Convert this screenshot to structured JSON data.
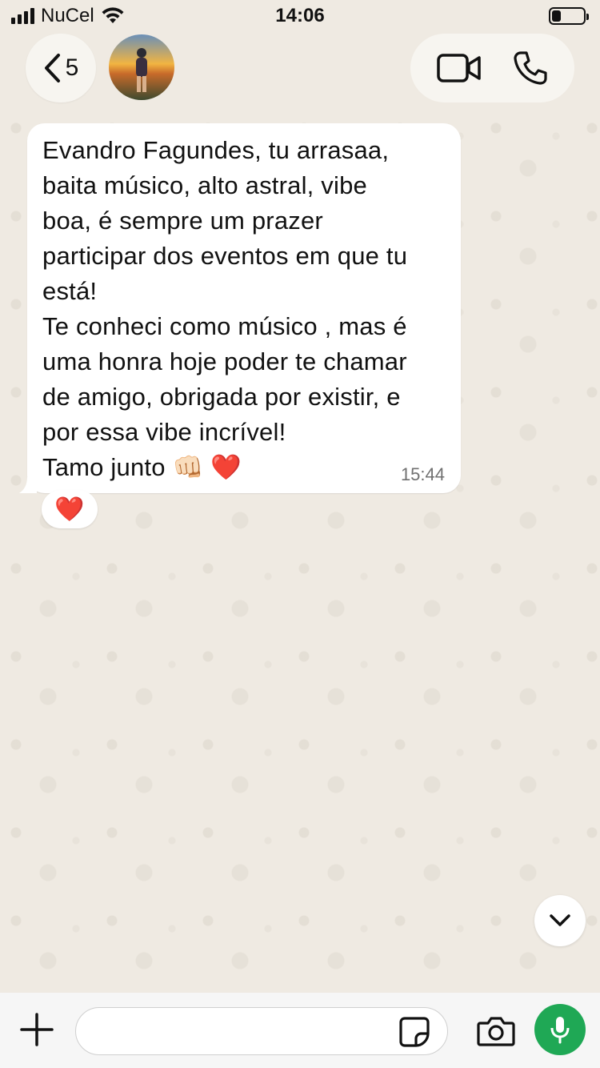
{
  "status_bar": {
    "carrier": "NuCel",
    "time": "14:06"
  },
  "header": {
    "back_count": "5",
    "icons": [
      "chevron-left-icon",
      "video-call-icon",
      "phone-icon"
    ]
  },
  "message": {
    "text": "Evandro Fagundes, tu arrasaa,\nbaita músico, alto astral, vibe\nboa, é sempre um prazer\nparticipar dos eventos em que tu\nestá!\nTe conheci como músico , mas é\numa honra hoje poder te chamar\nde amigo, obrigada por existir, e\npor essa vibe incrível!\nTamo junto 👊🏻 ❤️",
    "time": "15:44",
    "reaction": "❤️"
  },
  "input_bar": {
    "placeholder": "",
    "icons": [
      "plus-icon",
      "sticker-icon",
      "camera-icon",
      "microphone-icon"
    ]
  },
  "colors": {
    "background": "#efeae2",
    "bubble": "#ffffff",
    "mic_button": "#1fa855",
    "time_text": "#707070"
  }
}
